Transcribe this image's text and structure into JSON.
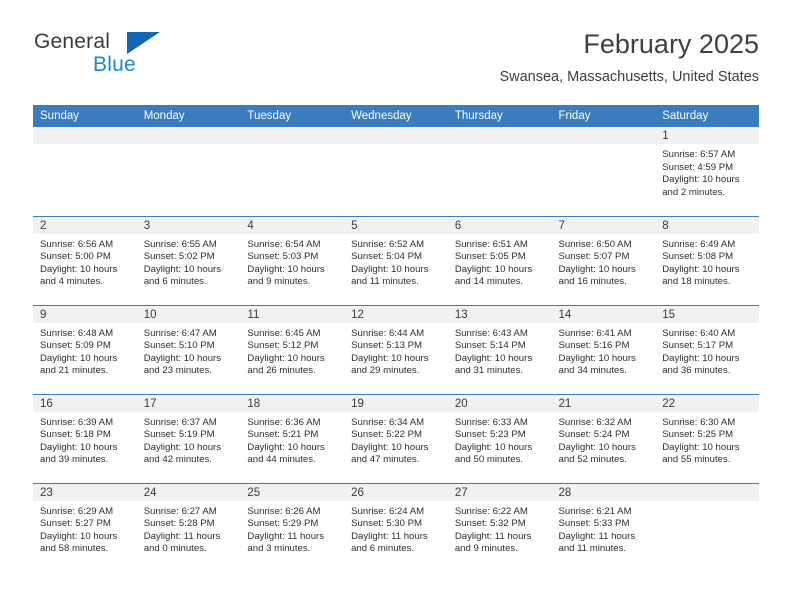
{
  "brand": {
    "name_top": "General",
    "name_bottom": "Blue",
    "accent_color": "#1267b2",
    "blue_text_color": "#1b85d6"
  },
  "header": {
    "title": "February 2025",
    "subtitle": "Swansea, Massachusetts, United States"
  },
  "calendar": {
    "header_bg": "#3a7cbe",
    "daynum_bg": "#f1f1f1",
    "weekday_headers": [
      "Sunday",
      "Monday",
      "Tuesday",
      "Wednesday",
      "Thursday",
      "Friday",
      "Saturday"
    ],
    "weeks": [
      [
        {
          "day": "",
          "empty": true
        },
        {
          "day": "",
          "empty": true
        },
        {
          "day": "",
          "empty": true
        },
        {
          "day": "",
          "empty": true
        },
        {
          "day": "",
          "empty": true
        },
        {
          "day": "",
          "empty": true
        },
        {
          "day": "1",
          "sunrise": "Sunrise: 6:57 AM",
          "sunset": "Sunset: 4:59 PM",
          "daylight": "Daylight: 10 hours and 2 minutes."
        }
      ],
      [
        {
          "day": "2",
          "sunrise": "Sunrise: 6:56 AM",
          "sunset": "Sunset: 5:00 PM",
          "daylight": "Daylight: 10 hours and 4 minutes."
        },
        {
          "day": "3",
          "sunrise": "Sunrise: 6:55 AM",
          "sunset": "Sunset: 5:02 PM",
          "daylight": "Daylight: 10 hours and 6 minutes."
        },
        {
          "day": "4",
          "sunrise": "Sunrise: 6:54 AM",
          "sunset": "Sunset: 5:03 PM",
          "daylight": "Daylight: 10 hours and 9 minutes."
        },
        {
          "day": "5",
          "sunrise": "Sunrise: 6:52 AM",
          "sunset": "Sunset: 5:04 PM",
          "daylight": "Daylight: 10 hours and 11 minutes."
        },
        {
          "day": "6",
          "sunrise": "Sunrise: 6:51 AM",
          "sunset": "Sunset: 5:05 PM",
          "daylight": "Daylight: 10 hours and 14 minutes."
        },
        {
          "day": "7",
          "sunrise": "Sunrise: 6:50 AM",
          "sunset": "Sunset: 5:07 PM",
          "daylight": "Daylight: 10 hours and 16 minutes."
        },
        {
          "day": "8",
          "sunrise": "Sunrise: 6:49 AM",
          "sunset": "Sunset: 5:08 PM",
          "daylight": "Daylight: 10 hours and 18 minutes."
        }
      ],
      [
        {
          "day": "9",
          "sunrise": "Sunrise: 6:48 AM",
          "sunset": "Sunset: 5:09 PM",
          "daylight": "Daylight: 10 hours and 21 minutes."
        },
        {
          "day": "10",
          "sunrise": "Sunrise: 6:47 AM",
          "sunset": "Sunset: 5:10 PM",
          "daylight": "Daylight: 10 hours and 23 minutes."
        },
        {
          "day": "11",
          "sunrise": "Sunrise: 6:45 AM",
          "sunset": "Sunset: 5:12 PM",
          "daylight": "Daylight: 10 hours and 26 minutes."
        },
        {
          "day": "12",
          "sunrise": "Sunrise: 6:44 AM",
          "sunset": "Sunset: 5:13 PM",
          "daylight": "Daylight: 10 hours and 29 minutes."
        },
        {
          "day": "13",
          "sunrise": "Sunrise: 6:43 AM",
          "sunset": "Sunset: 5:14 PM",
          "daylight": "Daylight: 10 hours and 31 minutes."
        },
        {
          "day": "14",
          "sunrise": "Sunrise: 6:41 AM",
          "sunset": "Sunset: 5:16 PM",
          "daylight": "Daylight: 10 hours and 34 minutes."
        },
        {
          "day": "15",
          "sunrise": "Sunrise: 6:40 AM",
          "sunset": "Sunset: 5:17 PM",
          "daylight": "Daylight: 10 hours and 36 minutes."
        }
      ],
      [
        {
          "day": "16",
          "sunrise": "Sunrise: 6:39 AM",
          "sunset": "Sunset: 5:18 PM",
          "daylight": "Daylight: 10 hours and 39 minutes."
        },
        {
          "day": "17",
          "sunrise": "Sunrise: 6:37 AM",
          "sunset": "Sunset: 5:19 PM",
          "daylight": "Daylight: 10 hours and 42 minutes."
        },
        {
          "day": "18",
          "sunrise": "Sunrise: 6:36 AM",
          "sunset": "Sunset: 5:21 PM",
          "daylight": "Daylight: 10 hours and 44 minutes."
        },
        {
          "day": "19",
          "sunrise": "Sunrise: 6:34 AM",
          "sunset": "Sunset: 5:22 PM",
          "daylight": "Daylight: 10 hours and 47 minutes."
        },
        {
          "day": "20",
          "sunrise": "Sunrise: 6:33 AM",
          "sunset": "Sunset: 5:23 PM",
          "daylight": "Daylight: 10 hours and 50 minutes."
        },
        {
          "day": "21",
          "sunrise": "Sunrise: 6:32 AM",
          "sunset": "Sunset: 5:24 PM",
          "daylight": "Daylight: 10 hours and 52 minutes."
        },
        {
          "day": "22",
          "sunrise": "Sunrise: 6:30 AM",
          "sunset": "Sunset: 5:25 PM",
          "daylight": "Daylight: 10 hours and 55 minutes."
        }
      ],
      [
        {
          "day": "23",
          "sunrise": "Sunrise: 6:29 AM",
          "sunset": "Sunset: 5:27 PM",
          "daylight": "Daylight: 10 hours and 58 minutes."
        },
        {
          "day": "24",
          "sunrise": "Sunrise: 6:27 AM",
          "sunset": "Sunset: 5:28 PM",
          "daylight": "Daylight: 11 hours and 0 minutes."
        },
        {
          "day": "25",
          "sunrise": "Sunrise: 6:26 AM",
          "sunset": "Sunset: 5:29 PM",
          "daylight": "Daylight: 11 hours and 3 minutes."
        },
        {
          "day": "26",
          "sunrise": "Sunrise: 6:24 AM",
          "sunset": "Sunset: 5:30 PM",
          "daylight": "Daylight: 11 hours and 6 minutes."
        },
        {
          "day": "27",
          "sunrise": "Sunrise: 6:22 AM",
          "sunset": "Sunset: 5:32 PM",
          "daylight": "Daylight: 11 hours and 9 minutes."
        },
        {
          "day": "28",
          "sunrise": "Sunrise: 6:21 AM",
          "sunset": "Sunset: 5:33 PM",
          "daylight": "Daylight: 11 hours and 11 minutes."
        },
        {
          "day": "",
          "empty": true
        }
      ]
    ]
  }
}
